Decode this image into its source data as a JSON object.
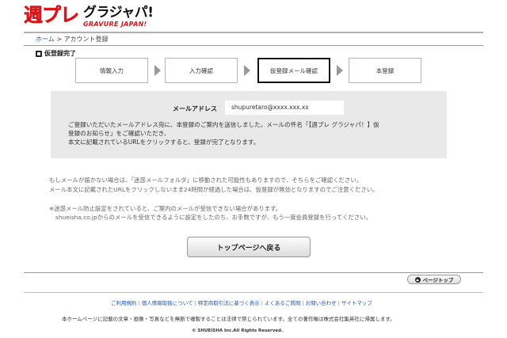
{
  "header": {
    "logo_main": "週プレ",
    "logo_jp": "グラジャパ!",
    "logo_en": "GRAVURE JAPAN!"
  },
  "breadcrumb": {
    "home": "ホーム",
    "separator": ">",
    "current": "アカウント登録"
  },
  "section": {
    "title": "仮登録完了"
  },
  "steps": [
    {
      "label": "情報入力",
      "active": false
    },
    {
      "label": "入力確認",
      "active": false
    },
    {
      "label": "仮登録メール確認",
      "active": true
    },
    {
      "label": "本登録",
      "active": false
    }
  ],
  "panel": {
    "email_label": "メールアドレス",
    "email_value": "shupuretaro@xxxx.xxx.xx",
    "message_line1": "ご登録いただいたメールアドレス宛に、本登録のご案内を送信しました。メールの件名「【週プレ グラジャパ！】仮",
    "message_line2": "登録のお知らせ」をご確認いただき、",
    "message_line3": "本文に記載されているURLをクリックすると、登録が完了となります。"
  },
  "notes": {
    "line1": "もしメールが届かない場合は、「迷惑メールフォルダ」に移動された可能性もありますので、そちらをご確認ください。",
    "line2": "メール本文に記載されたURLをクリックしないまま24時間が経過した場合は、仮登録が無効となりますのでご注意ください。",
    "line3": "※迷惑メール防止設定をされていると、ご案内のメールが受信できない場合があります。",
    "line4": "shueisha.co.jpからのメールを受信できるように設定をしたのち、お手数ですが、もう一度会員登録を行ってください。"
  },
  "buttons": {
    "back_top": "トップページへ戻る",
    "page_top": "ページトップ"
  },
  "footer": {
    "links": [
      "ご利用規約",
      "個人情報取扱について",
      "特定商取引法に基づく表示",
      "よくあるご質問",
      "お問い合わせ",
      "サイトマップ"
    ],
    "separator": "|",
    "notice": "本ホームページに記載の文章・画像・写真などを無断で複製することは法律で禁じられています。全ての著作権は株式会社集英社に帰属します。",
    "copyright": "© SHUEISHA Inc.All Rights Reserved."
  },
  "colors": {
    "brand_red": "#d9161c",
    "link_blue": "#2255aa",
    "panel_gray": "#e9e9e9"
  }
}
